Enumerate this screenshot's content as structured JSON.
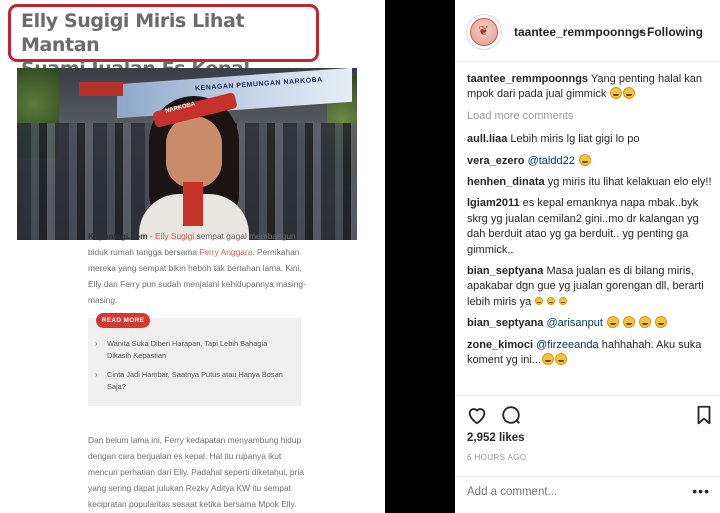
{
  "article": {
    "headline_line1": "Elly Sugigi Miris Lihat Mantan",
    "headline_line2": "Suami Jualan Es Kepal",
    "photo_banner": "KENAGAN PEMUNGAN NARKOBA",
    "headband_text": "NARKOBA",
    "para1_source": "Kapanlagi.com",
    "para1_dash": " - ",
    "para1_name1": "Elly Sugigi",
    "para1_mid": " sempat gagal membangun biduk rumah tangga bersama ",
    "para1_name2": "Ferry Anggara",
    "para1_rest": ". Pernikahan mereka yang sempat bikin heboh tak bertahan lama. Kini, Elly dan Ferry pun sudah menjalani kehidupannya masing-masing.",
    "readmore_label": "READ MORE",
    "readmore_links": [
      "Wanita Suka Diberi Harapan, Tapi Lebih Bahagia Dikasih Kepastian",
      "Cinta Jadi Hambar, Saatnya Putus atau Hanya Bosan Saja?"
    ],
    "para2_start": "Dan belum lama ini, Ferry kedapatan menyambung hidup dengan cara berjualan es kepal. Hal itu rupanya ikut mencuri perhatian dari Elly. Padahal seperti diketahui, pria yang sering dapat julukan ",
    "para2_bold": "Rezky Aditya",
    "para2_end": " KW itu sempat kecipratan popularitas sesaat ketika bersama Mpok Elly."
  },
  "header": {
    "username": "taantee_remmpoonngs",
    "separator": "•",
    "follow_label": "Following"
  },
  "caption": {
    "user": "taantee_remmpoonngs",
    "text": "Yang penting halal kan mpok dari pada jual gimmick"
  },
  "load_more": "Load more comments",
  "comments": [
    {
      "user": "aull.liaa",
      "text": "Lebih miris lg liat gigi lo po"
    },
    {
      "user": "vera_ezero",
      "mention": "@taldd22",
      "text": ""
    },
    {
      "user": "henhen_dinata",
      "text": "yg miris itu lihat kelakuan elo ely!!"
    },
    {
      "user": "lgiam2011",
      "text": "es kepal emanknya napa mbak..byk skrg yg jualan cemilan2 gini..mo dr kalangan yg dah berduit atao yg ga berduit.. yg penting ga gimmick.."
    },
    {
      "user": "bian_septyana",
      "text": "Masa jualan es di bilang miris, apakabar dgn gue yg jualan gorengan dll, berarti lebih miris ya"
    },
    {
      "user": "bian_septyana",
      "mention": "@arisanput",
      "text": ""
    },
    {
      "user": "zone_kimoci",
      "mention": "@firzeeanda",
      "text": "hahhahah. Aku suka koment yg ini..."
    }
  ],
  "likes": "2,952 likes",
  "time_ago": "6 HOURS AGO",
  "add_comment_placeholder": "Add a comment...",
  "more_dots": "•••",
  "colors": {
    "accent_red": "#c0242e",
    "mention_blue": "#003569",
    "muted_gray": "#999999"
  }
}
